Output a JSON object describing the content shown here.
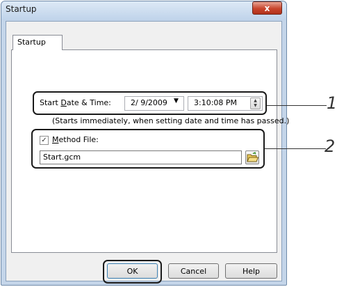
{
  "window": {
    "title": "Startup",
    "close_label": "x"
  },
  "tab": {
    "label": "Startup"
  },
  "start": {
    "label_pre": "Start ",
    "label_ul": "D",
    "label_post": "ate & Time:",
    "date_value": "2/  9/2009",
    "time_value": "3:10:08 PM",
    "hint": "(Starts immediately, when setting date and time has passed.)"
  },
  "method": {
    "checked": true,
    "label_ul": "M",
    "label_post": "ethod File:",
    "file_value": "Start.gcm"
  },
  "buttons": {
    "ok": "OK",
    "cancel": "Cancel",
    "help": "Help"
  },
  "callouts": {
    "one": "1",
    "two": "2"
  },
  "icons": {
    "close": "close-icon",
    "dropdown": "chevron-down-icon",
    "spin": "spinner-icon",
    "check": "checkmark-icon",
    "browse": "folder-open-icon"
  }
}
